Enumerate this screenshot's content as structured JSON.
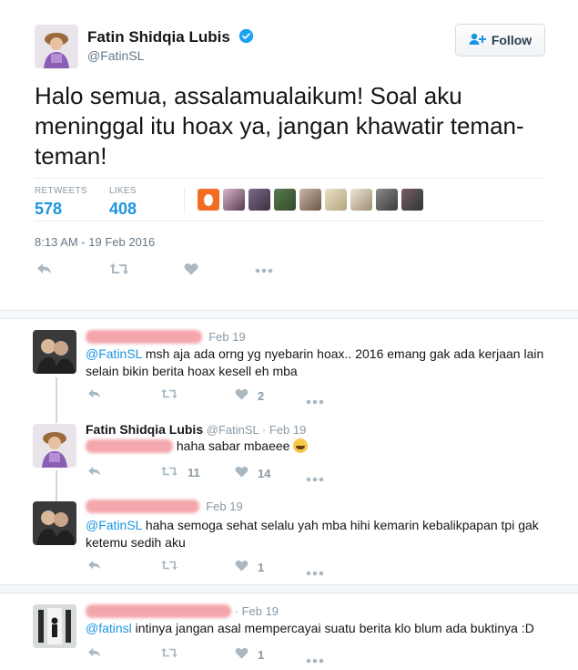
{
  "main_tweet": {
    "author_name": "Fatin Shidqia Lubis",
    "handle": "@FatinSL",
    "follow_label": "Follow",
    "text": "Halo semua, assalamualaikum! Soal aku meninggal itu hoax ya, jangan khawatir teman-teman!",
    "retweets_label": "RETWEETS",
    "retweets_count": "578",
    "likes_label": "LIKES",
    "likes_count": "408",
    "timestamp": "8:13 AM - 19 Feb 2016"
  },
  "colors": {
    "accent": "#1b95e0",
    "verified": "#1da1f2",
    "redaction": "#f08a92"
  },
  "replies": [
    {
      "author": "",
      "date": "Feb 19",
      "mention": "@FatinSL",
      "text": " msh aja ada orng yg nyebarin hoax.. 2016 emang gak ada kerjaan lain selain bikin berita hoax kesell eh mba",
      "retweets": "",
      "likes": "2"
    },
    {
      "author": "Fatin Shidqia Lubis",
      "handle": "@FatinSL",
      "date": "· Feb 19",
      "mention": "",
      "text": " haha sabar mbaeee",
      "retweets": "11",
      "likes": "14"
    },
    {
      "author": "",
      "date": "Feb 19",
      "mention": "@FatinSL",
      "text": " haha semoga sehat selalu yah mba hihi kemarin kebalikpapan tpi gak ketemu sedih aku",
      "retweets": "",
      "likes": "1"
    },
    {
      "author": "",
      "date": "· Feb 19",
      "mention": "@fatinsl",
      "text": " intinya jangan asal mempercayai suatu berita klo blum ada buktinya :D",
      "retweets": "",
      "likes": "1"
    }
  ]
}
